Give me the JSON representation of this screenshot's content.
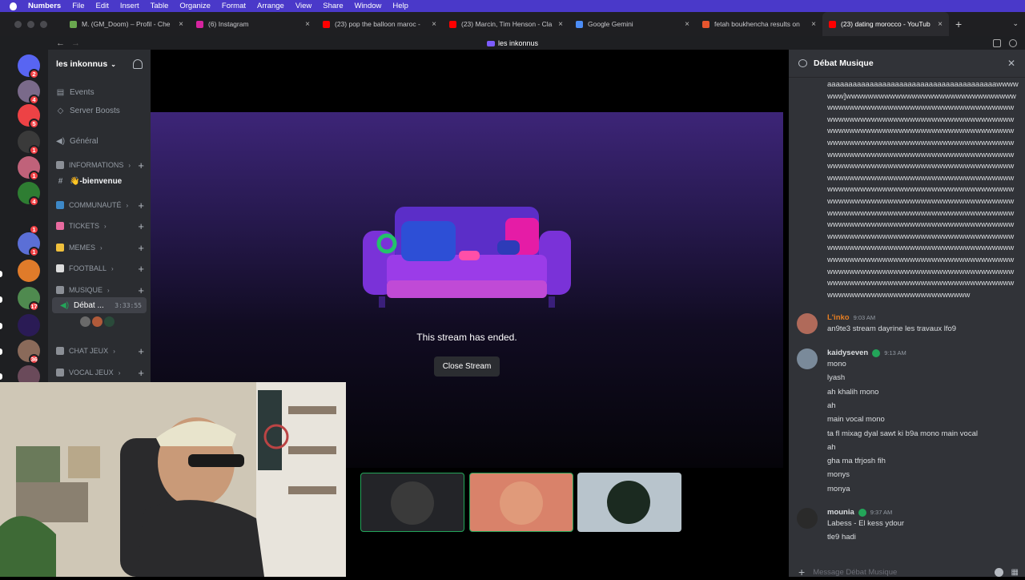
{
  "menubar": {
    "app_name": "Numbers",
    "items": [
      "File",
      "Edit",
      "Insert",
      "Table",
      "Organize",
      "Format",
      "Arrange",
      "View",
      "Share",
      "Window",
      "Help"
    ]
  },
  "browser": {
    "tabs": [
      {
        "label": "M. (GM_Doom) – Profil - Che",
        "color": "#6aa84f"
      },
      {
        "label": "(6) Instagram",
        "color": "#d6249f"
      },
      {
        "label": "(23) pop the balloon maroc -",
        "color": "#ff0000"
      },
      {
        "label": "(23) Marcin, Tim Henson - Cla",
        "color": "#ff0000"
      },
      {
        "label": "Google Gemini",
        "color": "#4c8df6"
      },
      {
        "label": "fetah boukhencha results on",
        "color": "#e8552e"
      },
      {
        "label": "(23) dating morocco - YouTub",
        "color": "#ff0000"
      }
    ],
    "page_title": "les inkonnus"
  },
  "server_rail": {
    "servers": [
      {
        "icon": "discord-home-icon",
        "color": "#5865f2",
        "badge": "2"
      },
      {
        "icon": "server-avatar-1",
        "color": "#7a6a8a",
        "badge": "4"
      },
      {
        "icon": "server-avatar-2",
        "color": "#ed4245",
        "badge": "5"
      },
      {
        "icon": "server-avatar-3",
        "color": "#3a3a3a",
        "badge": "1"
      },
      {
        "icon": "server-avatar-4",
        "color": "#c0627a",
        "badge": "1"
      },
      {
        "icon": "server-avatar-5",
        "color": "#2e7d32",
        "badge": "4"
      },
      {
        "icon": "server-avatar-6",
        "color": "#1e1f22",
        "badge": "1"
      },
      {
        "icon": "server-avatar-7",
        "color": "#5b6fd6",
        "badge": "1"
      },
      {
        "icon": "server-avatar-8",
        "color": "#e07b2a",
        "badge": ""
      },
      {
        "icon": "server-avatar-9",
        "color": "#4f8a4f",
        "badge": "17"
      },
      {
        "icon": "server-avatar-10",
        "color": "#2a1b55",
        "badge": ""
      },
      {
        "icon": "server-avatar-11",
        "color": "#8a6a5a",
        "badge": "36"
      },
      {
        "icon": "server-avatar-12",
        "color": "#6a4a5a",
        "badge": ""
      }
    ]
  },
  "channels": {
    "server_name": "les inkonnus",
    "items": [
      {
        "label": "Events",
        "glyph": "▤",
        "kind": "link"
      },
      {
        "label": "Server Boosts",
        "glyph": "◇",
        "kind": "link"
      },
      {
        "label": "Général",
        "glyph": "◀)",
        "kind": "voice"
      },
      {
        "label": "INFORMATIONS",
        "kind": "category",
        "color": "#8b8f96"
      },
      {
        "label": "👋-bienvenue",
        "glyph": "#",
        "kind": "text-unread"
      },
      {
        "label": "COMMUNAUTÉ",
        "kind": "category",
        "color": "#3d88c7"
      },
      {
        "label": "TICKETS",
        "kind": "category",
        "color": "#e86a9f"
      },
      {
        "label": "MEMES",
        "kind": "category",
        "color": "#f0c03c"
      },
      {
        "label": "FOOTBALL",
        "kind": "category",
        "color": "#dddddd"
      },
      {
        "label": "MUSIQUE",
        "kind": "category",
        "color": "#8b8f96"
      },
      {
        "label": "Débat ...",
        "kind": "voice-active",
        "timer": "3:33:55"
      },
      {
        "label": "CHAT JEUX",
        "kind": "category",
        "color": "#8b8f96"
      },
      {
        "label": "VOCAL JEUX",
        "kind": "category",
        "color": "#8b8f96"
      }
    ]
  },
  "stage": {
    "ended_text": "This stream has ended.",
    "close_button": "Close Stream",
    "tiles": [
      {
        "name": "participant-tile-1",
        "bg": "#232428",
        "border": "#23a559",
        "avatar": "#3a3a3a"
      },
      {
        "name": "participant-tile-2",
        "bg": "#d9826a",
        "border": "#23a559",
        "avatar": "#e09a7a"
      },
      {
        "name": "participant-tile-3",
        "bg": "#b8c4cc",
        "border": "none",
        "avatar": "#1b2a20"
      }
    ]
  },
  "chat": {
    "title": "Débat Musique",
    "spam_text": "aaaaaaaaaaaaaaaaaaaaaaaaaaaaaaaaaaaaaaaawwwwwww]wwwwwwwwwwwwwwwwwwwwwwwwwwwwwwwwwwwwwwwwwwwwwwwwwwwwwwwwwwwwwwwwwwwwwwwwwwwwwwwwwwwwwwwwwwwwwwwwwwwwwwwwwwwwwwwwwwwwwwwwwwwwwwwwwwwwwwwwwwwwwwwwwwwwwwwwwwwwwwwwwwwwwwwwwwwwwwwwwwwwwwwwwwwwwwwwwwwwwwwwwwwwwwwwwwwwwwwwwwwwwwwwwwwwwwwwwwwwwwwwwwwwwwwwwwwwwwwwwwwwwwwwwwwwwwwwwwwwwwwwwwwwwwwwwwwwwwwwwwwwwwwwwwwwwwwwwwwwwwwwwwwwwwwwwwwwwwwwwwwwwwwwwwwwwwwwwwwwwwwwwwwwwwwwwwwwwwwwwwwwwwwwwwwwwwwwwwwwwwwwwwwwwwwwwwwwwwwwwwwwwwwwwwwwwwwwwwwwwwwwwwwwwwwwwwwwwwwwwwwwwwwwwwwwwwwwwwwwwwwwwwwwwwwwwwwwwwwwwwwwwwwwwwwwwwwwwwwwwwwwwwwwwwwwwwwwwwwwwwwwwwwwwwwwwwwwwwwwwwwwwwwwwwwwwwwwwwwwwwwwwwwwwwwwwwwwwwwwwwwww",
    "messages": [
      {
        "author": "L'inko",
        "author_color": "#e67e22",
        "time": "9:03 AM",
        "avatar": "#b06a5a",
        "verified": false,
        "lines": [
          "an9te3 stream dayrine les travaux lfo9"
        ]
      },
      {
        "author": "kaidyseven",
        "author_color": "#dbdee1",
        "time": "9:13 AM",
        "avatar": "#7a8a9a",
        "verified": true,
        "lines": [
          "mono",
          "lyash",
          "ah khalih mono",
          "ah",
          "main vocal mono",
          "ta fl mixag dyal sawt ki b9a mono main vocal",
          "ah",
          "gha ma tfrjosh fih",
          "monys",
          "monya"
        ]
      },
      {
        "author": "mounia",
        "author_color": "#dbdee1",
        "time": "9:37 AM",
        "avatar": "#2a2a2a",
        "verified": true,
        "lines": [
          "Labess - El kess ydour",
          "tle9 hadi"
        ]
      }
    ],
    "input_placeholder": "Message Débat Musique"
  }
}
